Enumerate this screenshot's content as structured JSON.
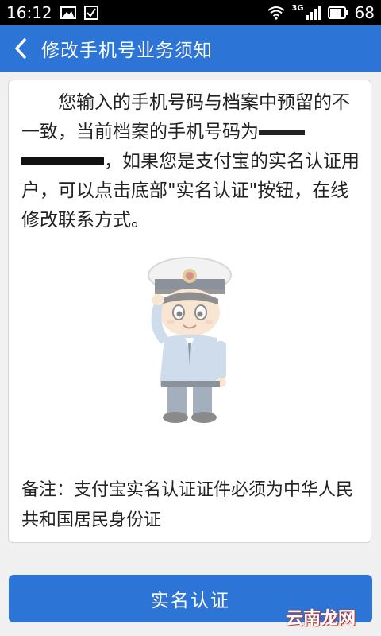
{
  "status_bar": {
    "time": "16:12",
    "network": "3G",
    "battery": "68",
    "icons": [
      "image-icon",
      "checkbox-icon",
      "wifi-icon",
      "signal-icon",
      "battery-icon"
    ]
  },
  "header": {
    "title": "修改手机号业务须知",
    "background": "#2c74d6"
  },
  "notice": {
    "part1": "您输入的手机号码与档案中预留的不一致，当前档案的手机号码为",
    "part2": "，如果您是支付宝的实名认证用户，可以点击底部\"实名认证\"按钮，在线修改联系方式。"
  },
  "illustration": {
    "name": "police-officer-saluting"
  },
  "note": {
    "text": "备注：支付宝实名认证证件必须为中华人民共和国居民身份证"
  },
  "bottom_button": {
    "label": "实名认证"
  },
  "watermark": {
    "text": "云南龙网"
  }
}
